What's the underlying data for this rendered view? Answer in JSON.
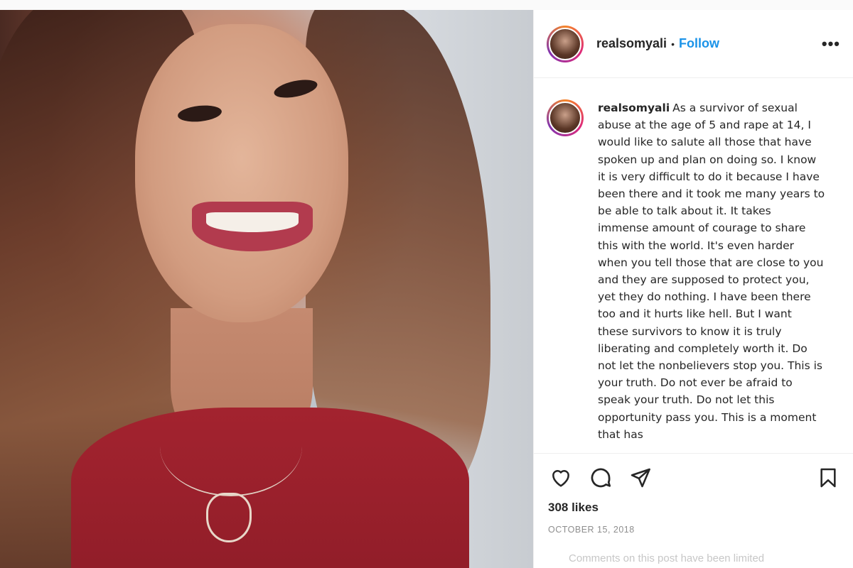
{
  "post": {
    "username": "realsomyali",
    "follow_label": "Follow",
    "dot": "•",
    "more_label": "•••",
    "caption": "As a survivor of sexual abuse at the age of 5 and rape at 14, I would like to salute all those that have spoken up and plan on doing so. I know it is very difficult to do it because I have been there and it took me many years to be able to talk about it. It takes immense amount of courage to share this with the world. It's even harder when you tell those that are close to you and they are supposed to protect you, yet they do nothing. I have been there too and it hurts like hell. But I want these survivors to know it is truly liberating and completely worth it. Do not let the nonbelievers stop you. This is your truth. Do not ever be afraid to speak your truth. Do not let this opportunity pass you. This is a moment that has",
    "likes": "308 likes",
    "date": "OCTOBER 15, 2018",
    "comments_notice": "Comments on this post have been limited"
  },
  "icons": {
    "like": "heart-icon",
    "comment": "comment-icon",
    "share": "share-icon",
    "save": "bookmark-icon",
    "more": "more-icon"
  },
  "colors": {
    "follow": "#1b93e8",
    "text": "#262626",
    "muted": "#8e8e8e"
  }
}
